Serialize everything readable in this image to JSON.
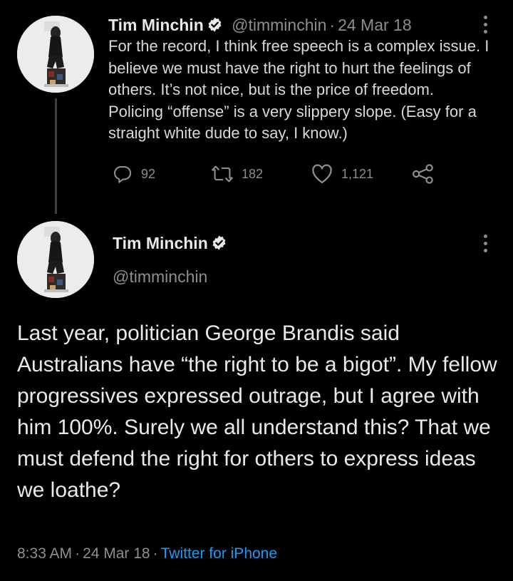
{
  "colors": {
    "background": "#000000",
    "text_primary": "#e7e9ea",
    "text_secondary": "#8b8f93",
    "link": "#1d9bf0",
    "thread_line": "#3a3f44"
  },
  "tweet1": {
    "author_name": "Tim Minchin",
    "handle": "@timminchin",
    "separator": "·",
    "date": "24 Mar 18",
    "text": "For the record, I think free speech is a complex issue. I believe we must have the right to hurt the feelings of others. It’s not nice, but is the price of freedom. Policing “offense” is a very slippery slope. (Easy for a straight white dude to say, I know.)",
    "actions": {
      "reply": {
        "icon": "reply-icon",
        "count": "92"
      },
      "retweet": {
        "icon": "retweet-icon",
        "count": "182"
      },
      "like": {
        "icon": "heart-icon",
        "count": "1,121"
      },
      "share": {
        "icon": "share-icon"
      }
    }
  },
  "tweet2": {
    "author_name": "Tim Minchin",
    "handle": "@timminchin",
    "text": "Last year, politician George Brandis said Australians have “the right to be a bigot”. My fellow progressives expressed outrage, but I agree with him 100%. Surely we all understand this? That we must defend the right for others to express ideas we loathe?",
    "time": "8:33 AM",
    "separator": "·",
    "date": "24 Mar 18",
    "source": "Twitter for iPhone"
  }
}
